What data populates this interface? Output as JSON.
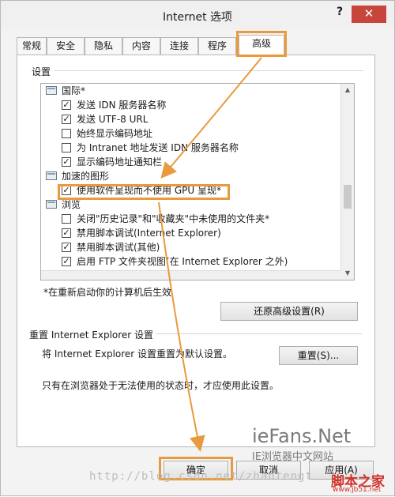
{
  "window": {
    "title": "Internet 选项",
    "help_glyph": "?",
    "close_glyph": "✕"
  },
  "tabs": [
    {
      "label": "常规"
    },
    {
      "label": "安全"
    },
    {
      "label": "隐私"
    },
    {
      "label": "内容"
    },
    {
      "label": "连接"
    },
    {
      "label": "程序"
    },
    {
      "label": "高级",
      "active": true
    }
  ],
  "settings": {
    "group_label": "设置",
    "items": [
      {
        "kind": "category",
        "label": "国际*"
      },
      {
        "kind": "check",
        "checked": true,
        "label": "发送 IDN 服务器名称"
      },
      {
        "kind": "check",
        "checked": true,
        "label": "发送 UTF-8 URL"
      },
      {
        "kind": "check",
        "checked": false,
        "label": "始终显示编码地址"
      },
      {
        "kind": "check",
        "checked": false,
        "label": "为 Intranet 地址发送 IDN 服务器名称"
      },
      {
        "kind": "check",
        "checked": true,
        "label": "显示编码地址通知栏"
      },
      {
        "kind": "category",
        "label": "加速的图形"
      },
      {
        "kind": "check",
        "checked": true,
        "label": "使用软件呈现而不使用 GPU 呈现*"
      },
      {
        "kind": "category",
        "label": "浏览"
      },
      {
        "kind": "check",
        "checked": false,
        "label": "关闭\"历史记录\"和\"收藏夹\"中未使用的文件夹*"
      },
      {
        "kind": "check",
        "checked": true,
        "label": "禁用脚本调试(Internet Explorer)"
      },
      {
        "kind": "check",
        "checked": true,
        "label": "禁用脚本调试(其他)"
      },
      {
        "kind": "check",
        "checked": true,
        "label": "启用 FTP 文件夹视图(在 Internet Explorer 之外)"
      }
    ],
    "note": "*在重新启动你的计算机后生效",
    "restore_button": "还原高级设置(R)"
  },
  "reset": {
    "group_title": "重置 Internet Explorer 设置",
    "description": "将 Internet Explorer 设置重置为默认设置。",
    "button": "重置(S)...",
    "warning": "只有在浏览器处于无法使用的状态时，才应使用此设置。"
  },
  "footer": {
    "ok": "确定",
    "cancel": "取消",
    "apply": "应用(A)"
  },
  "watermarks": {
    "brand": "ieFans.Net",
    "brand_sub": "IE浏览器中文网站",
    "url": "http://blog.csdn.net/zhaotengt",
    "jb": "脚本之家",
    "jb_url": "www.jb51.net"
  },
  "colors": {
    "highlight_box": "#e89a3c",
    "close_button": "#c7463b",
    "jb_red": "#d0322a"
  }
}
